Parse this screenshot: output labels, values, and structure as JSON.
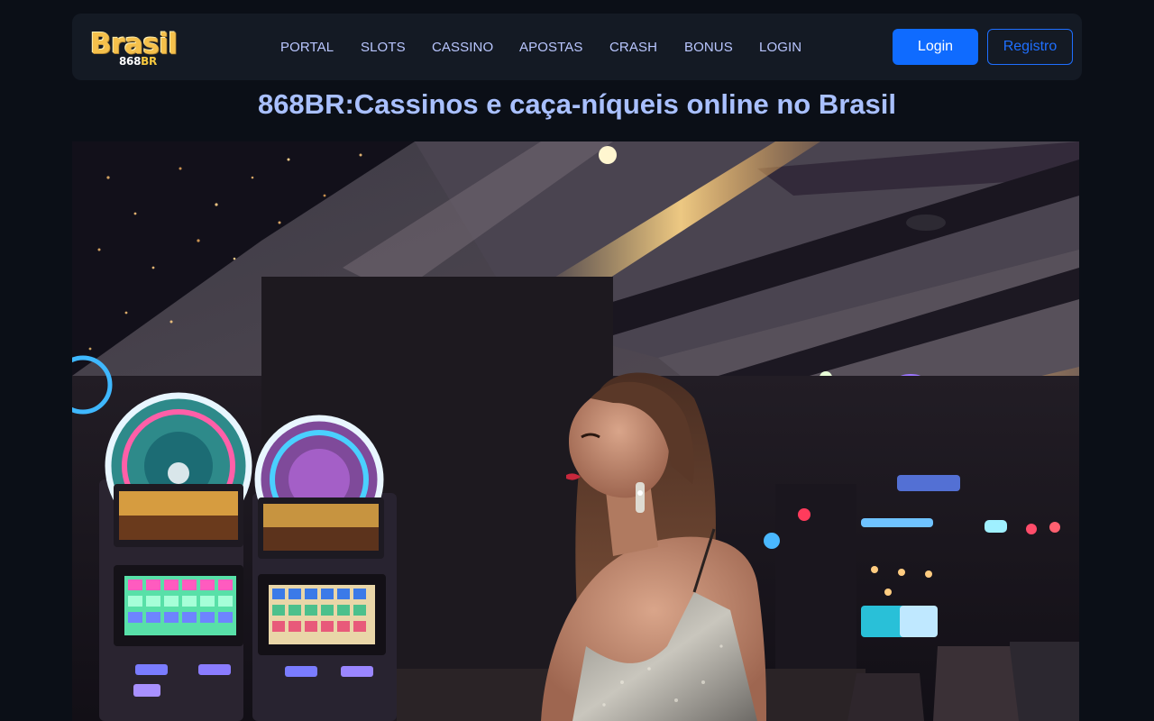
{
  "header": {
    "logo": {
      "main": "Brasil",
      "sub_prefix": "868",
      "sub_suffix": "BR"
    },
    "nav": [
      "PORTAL",
      "SLOTS",
      "CASSINO",
      "APOSTAS",
      "CRASH",
      "BONUS",
      "LOGIN"
    ],
    "login_button": "Login",
    "register_button": "Registro"
  },
  "page_title": "868BR:Cassinos e caça-níqueis online no Brasil",
  "colors": {
    "background": "#0b0f17",
    "header_bg": "#141a24",
    "accent_blue": "#0f6bff",
    "title": "#a9c0ff",
    "logo_gold": "#f5c04b"
  }
}
